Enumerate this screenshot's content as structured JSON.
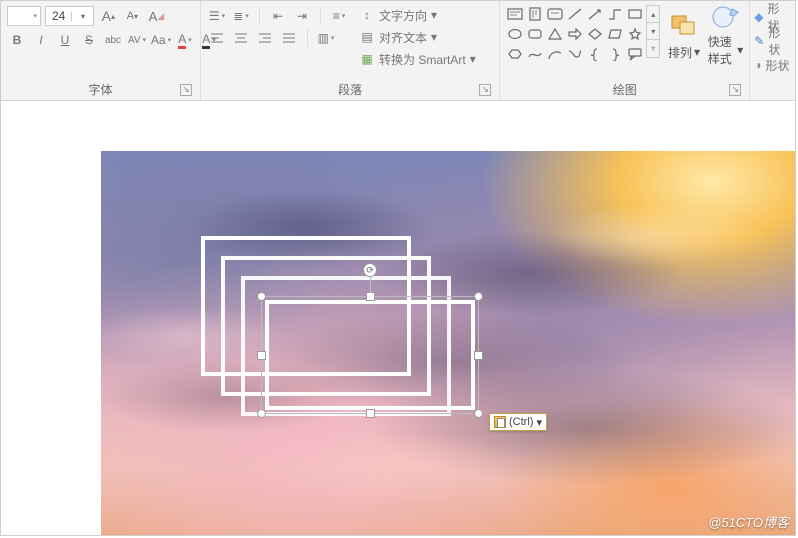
{
  "ribbon": {
    "font": {
      "label": "字体",
      "size_value": "24",
      "grow": "A",
      "shrink": "A",
      "bold": "B",
      "italic": "I",
      "underline": "U",
      "strike": "S",
      "shadow": "abc",
      "spacing": "AV",
      "caseMenu": "Aa",
      "colorA": "A",
      "highlightA": "A"
    },
    "paragraph": {
      "label": "段落",
      "textDirection": "文字方向",
      "alignText": "对齐文本",
      "smartArt": "转换为 SmartArt"
    },
    "draw": {
      "label": "绘图",
      "arrange": "排列",
      "quickStyle": "快速样式",
      "shapeFill": "形状",
      "shapeEdit": "形状",
      "shapeOutline": "形状"
    }
  },
  "pasteTag": "(Ctrl)",
  "watermark": "@51CTO博客"
}
